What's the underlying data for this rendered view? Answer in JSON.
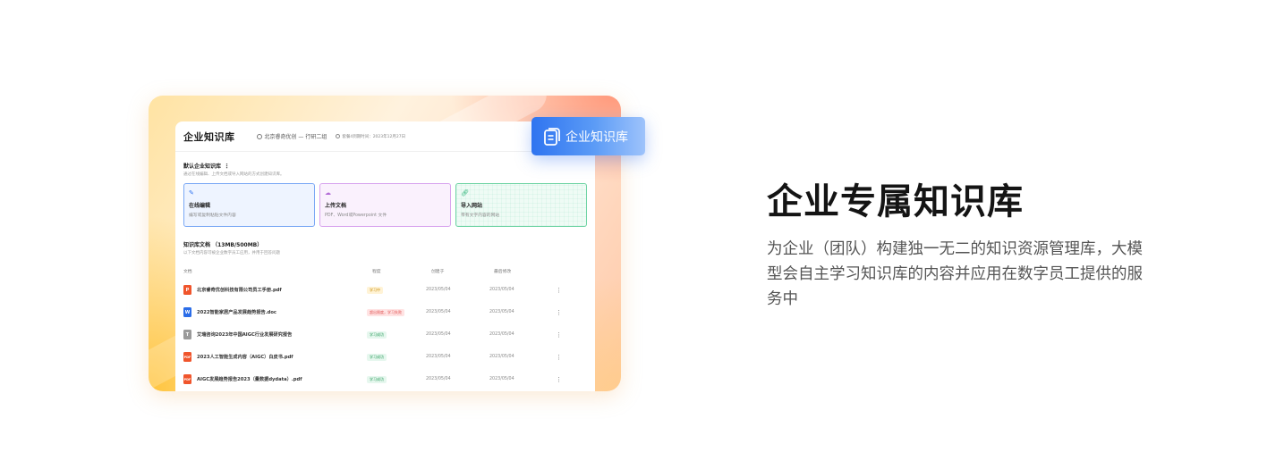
{
  "tag": {
    "label": "企业知识库"
  },
  "headline": "企业专属知识库",
  "description": "为企业（团队）构建独一无二的知识资源管理库，大模型会自主学习知识库的内容并应用在数字员工提供的服务中",
  "window": {
    "title": "企业知识库",
    "org": "北京睿奇优创 — 行研二组",
    "meta": "套餐4到期时间：2023年12月27日"
  },
  "default_kb": {
    "title": "默认企业知识库",
    "subtitle": "通过在线编辑、上传文档或导入网站的方式创建知识库。"
  },
  "tiles": [
    {
      "label": "在线编辑",
      "desc": "编写或复制粘贴文件内容"
    },
    {
      "label": "上传文档",
      "desc": "PDF、Word或Powerpoint 文件"
    },
    {
      "label": "导入网站",
      "desc": "带有文字内容的网站"
    }
  ],
  "docs": {
    "title": "知识库文档 （13MB/500MB）",
    "subtitle": "以下文档内容可被企业数字员工应用，并用于回答问题"
  },
  "table": {
    "headers": [
      "文档",
      "程度",
      "创建于",
      "最后修改"
    ],
    "rows": [
      {
        "icon": "P",
        "name": "北京睿奇优创科技有限公司员工手册.pdf",
        "status": "学习中",
        "created": "2023/05/04",
        "modified": "2023/05/04"
      },
      {
        "icon": "W",
        "name": "2022智能家居产品发展趋势报告.doc",
        "status": "超出限度，学习失败",
        "created": "2023/05/04",
        "modified": "2023/05/04"
      },
      {
        "icon": "T",
        "name": "艾瑞咨询2023年中国AIGC行业发展研究报告",
        "status": "学习成功",
        "created": "2023/05/04",
        "modified": "2023/05/04"
      },
      {
        "icon": "PDF",
        "name": "2023人工智能生成内容（AIGC）白皮书.pdf",
        "status": "学习成功",
        "created": "2023/05/04",
        "modified": "2023/05/04"
      },
      {
        "icon": "PDF",
        "name": "AIGC发展趋势报告2023（量数据dydata）.pdf",
        "status": "学习成功",
        "created": "2023/05/04",
        "modified": "2023/05/04"
      }
    ]
  },
  "colors": {
    "accent_blue": "#2f74f0",
    "pdf_red": "#f0552c",
    "word_blue": "#2b6de8"
  }
}
